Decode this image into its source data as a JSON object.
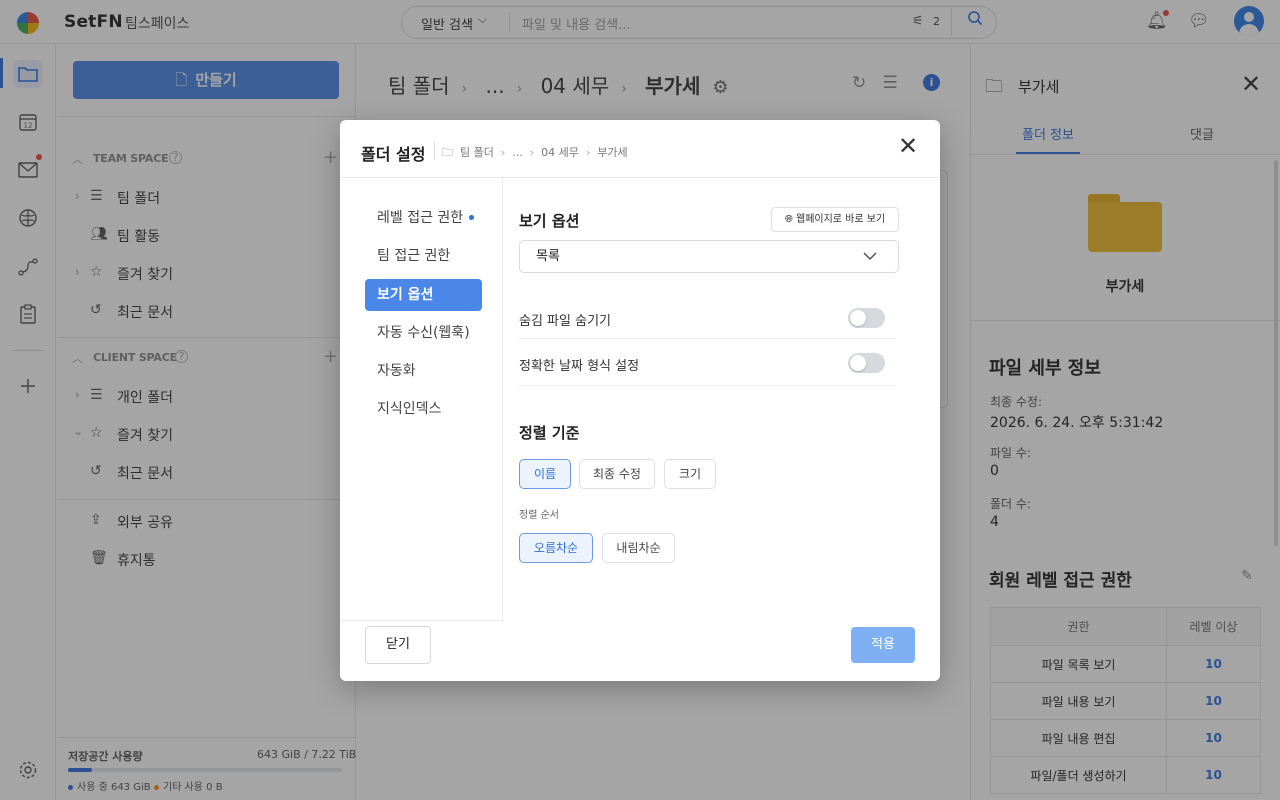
{
  "topbar": {
    "brand": "SetFN",
    "workspace": "팀스페이스",
    "search_mode": "일반 검색",
    "search_placeholder": "파일 및 내용 검색...",
    "filter_count": "2"
  },
  "sidebar": {
    "create_label": "만들기",
    "team_space": {
      "title": "TEAM SPACE",
      "items": [
        {
          "label": "팀 폴더",
          "icon": "folder-stack-icon"
        },
        {
          "label": "팀 활동",
          "icon": "people-icon"
        },
        {
          "label": "즐겨 찾기",
          "icon": "star-folder-icon"
        },
        {
          "label": "최근 문서",
          "icon": "history-icon"
        }
      ]
    },
    "client_space": {
      "title": "CLIENT SPACE",
      "items": [
        {
          "label": "개인 폴더",
          "icon": "folder-stack-icon"
        },
        {
          "label": "즐겨 찾기",
          "icon": "star-folder-icon"
        },
        {
          "label": "최근 문서",
          "icon": "history-icon"
        }
      ]
    },
    "extra_items": [
      {
        "label": "외부 공유",
        "icon": "share-icon"
      },
      {
        "label": "휴지통",
        "icon": "trash-icon"
      }
    ],
    "storage": {
      "label": "저장공간 사용량",
      "value": "643 GiB / 7.22 TiB",
      "used": "사용 중 643 GiB",
      "other": "기타 사용 0 B",
      "used_fraction": 0.087,
      "used_color": "#2d6ee0",
      "other_color": "#f08c2e"
    }
  },
  "main": {
    "breadcrumb": [
      "팀 폴더",
      "...",
      "04 세무",
      "부가세"
    ]
  },
  "right_panel": {
    "title": "부가세",
    "tabs": [
      "폴더 정보",
      "댓글"
    ],
    "folder_name": "부가세",
    "details_title": "파일 세부 정보",
    "modified_label": "최종 수정:",
    "modified_value": "2026. 6. 24. 오후 5:31:42",
    "files_label": "파일 수:",
    "files_value": "0",
    "folders_label": "폴더 수:",
    "folders_value": "4",
    "perm_title": "회원 레벨 접근 권한",
    "perm_headers": [
      "권한",
      "레벨 이상"
    ],
    "perm_rows": [
      {
        "name": "파일 목록 보기",
        "level": "10"
      },
      {
        "name": "파일 내용 보기",
        "level": "10"
      },
      {
        "name": "파일 내용 편집",
        "level": "10"
      },
      {
        "name": "파일/폴더 생성하기",
        "level": "10"
      }
    ]
  },
  "dialog": {
    "title": "폴더 설정",
    "breadcrumb": [
      "팀 폴더",
      "...",
      "04 세무",
      "부가세"
    ],
    "nav": [
      "레벨 접근 권한",
      "팀 접근 권한",
      "보기 옵션",
      "자동 수신(웹훅)",
      "자동화",
      "지식인덱스"
    ],
    "active_nav_index": 2,
    "options_title": "보기 옵션",
    "web_view_button": "웹페이지로 바로 보기",
    "view_select_value": "목록",
    "toggles": [
      {
        "label": "숨김 파일 숨기기",
        "on": false
      },
      {
        "label": "정확한 날짜 형식 설정",
        "on": false
      }
    ],
    "sort_title": "정렬 기준",
    "sort_by": [
      "이름",
      "최종 수정",
      "크기"
    ],
    "sort_by_selected": "이름",
    "order_label": "정렬 순서",
    "order": [
      "오름차순",
      "내림차순"
    ],
    "order_selected": "오름차순",
    "close_label": "닫기",
    "apply_label": "적용"
  }
}
